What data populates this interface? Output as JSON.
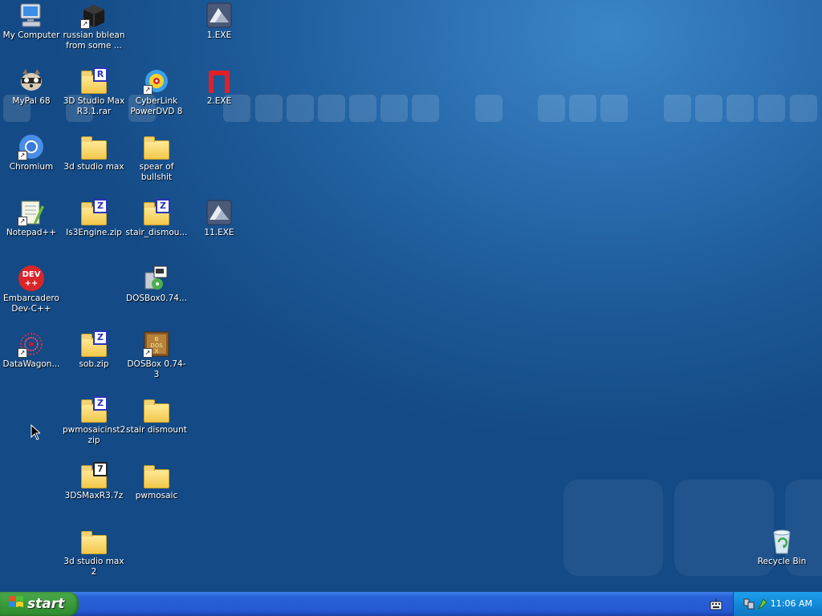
{
  "desktop": {
    "icons": [
      {
        "label": "My Computer",
        "icon": "my-computer-icon"
      },
      {
        "label": "russian bblean\nfrom some ...",
        "icon": "black-box-icon"
      },
      {
        "label": "1.EXE",
        "icon": "exe-icon"
      },
      {
        "label": "MyPal 68",
        "icon": "raccoon-browser-icon"
      },
      {
        "label": "3D Studio Max\nR3.1.rar",
        "icon": "rar-archive-icon"
      },
      {
        "label": "CyberLink\nPowerDVD 8",
        "icon": "dvd-player-icon"
      },
      {
        "label": "2.EXE",
        "icon": "red-exe-icon"
      },
      {
        "label": "Chromium",
        "icon": "chromium-icon"
      },
      {
        "label": "3d studio max",
        "icon": "folder-icon"
      },
      {
        "label": "spear of\nbullshit",
        "icon": "folder-icon"
      },
      {
        "label": "Notepad++",
        "icon": "notepad-plus-plus-icon"
      },
      {
        "label": "Is3Engine.zip",
        "icon": "zip-folder-icon"
      },
      {
        "label": "stair_dismou...",
        "icon": "zip-folder-icon"
      },
      {
        "label": "11.EXE",
        "icon": "exe-icon"
      },
      {
        "label": "Embarcadero\nDev-C++",
        "icon": "dev-cpp-icon"
      },
      {
        "label": "DOSBox0.74...",
        "icon": "installer-icon"
      },
      {
        "label": "DataWagon...",
        "icon": "datawagon-icon"
      },
      {
        "label": "sob.zip",
        "icon": "zip-folder-icon"
      },
      {
        "label": "DOSBox 0.74-3",
        "icon": "dosbox-icon"
      },
      {
        "label": "pwmosaicinst2.\nzip",
        "icon": "zip-folder-icon"
      },
      {
        "label": "stair dismount",
        "icon": "folder-icon"
      },
      {
        "label": "3DSMaxR3.7z",
        "icon": "7z-archive-icon"
      },
      {
        "label": "pwmosaic",
        "icon": "folder-icon"
      },
      {
        "label": "3d studio max\n2",
        "icon": "folder-icon"
      },
      {
        "label": "Recycle Bin",
        "icon": "recycle-bin-icon"
      }
    ]
  },
  "taskbar": {
    "start_label": "start",
    "clock": "11:06 AM"
  },
  "colors": {
    "desktop_blue": "#2a6eb0",
    "taskbar_blue": "#2458d0",
    "start_green": "#3a9a3a",
    "tray_blue": "#138ad8"
  }
}
